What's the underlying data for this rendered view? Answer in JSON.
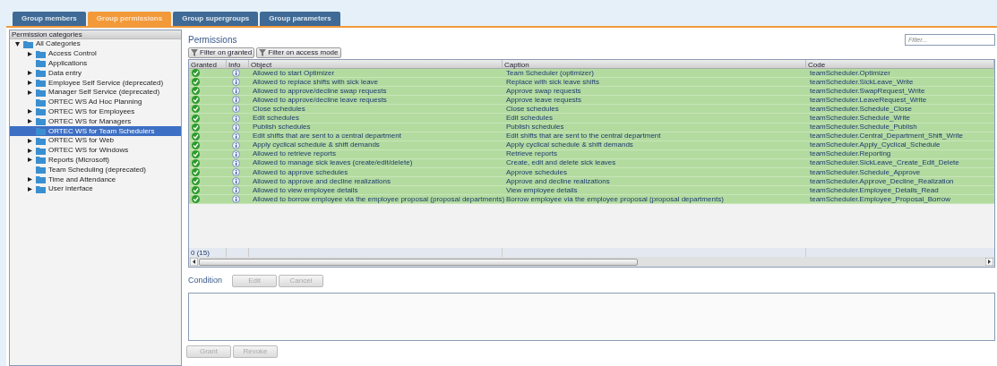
{
  "tabs": [
    {
      "label": "Group members",
      "selected": false
    },
    {
      "label": "Group permissions",
      "selected": true
    },
    {
      "label": "Group supergroups",
      "selected": false
    },
    {
      "label": "Group parameters",
      "selected": false
    }
  ],
  "categories": {
    "header": "Permission categories",
    "tree": [
      {
        "label": "All Categories",
        "expandable": true,
        "expanded": true,
        "selected": false,
        "children": [
          {
            "label": "Access Control",
            "expandable": true,
            "expanded": false,
            "selected": false
          },
          {
            "label": "Applications",
            "expandable": false,
            "expanded": false,
            "selected": false
          },
          {
            "label": "Data entry",
            "expandable": true,
            "expanded": false,
            "selected": false
          },
          {
            "label": "Employee Self Service (deprecated)",
            "expandable": true,
            "expanded": false,
            "selected": false
          },
          {
            "label": "Manager Self Service (deprecated)",
            "expandable": true,
            "expanded": false,
            "selected": false
          },
          {
            "label": "ORTEC WS Ad Hoc Planning",
            "expandable": false,
            "expanded": false,
            "selected": false
          },
          {
            "label": "ORTEC WS for Employees",
            "expandable": true,
            "expanded": false,
            "selected": false
          },
          {
            "label": "ORTEC WS for Managers",
            "expandable": true,
            "expanded": false,
            "selected": false
          },
          {
            "label": "ORTEC WS for Team Schedulers",
            "expandable": false,
            "expanded": false,
            "selected": true
          },
          {
            "label": "ORTEC WS for Web",
            "expandable": true,
            "expanded": false,
            "selected": false
          },
          {
            "label": "ORTEC WS for Windows",
            "expandable": true,
            "expanded": false,
            "selected": false
          },
          {
            "label": "Reports (Microsoft)",
            "expandable": true,
            "expanded": false,
            "selected": false
          },
          {
            "label": "Team Scheduling (deprecated)",
            "expandable": false,
            "expanded": false,
            "selected": false
          },
          {
            "label": "Time and Attendance",
            "expandable": true,
            "expanded": false,
            "selected": false
          },
          {
            "label": "User interface",
            "expandable": true,
            "expanded": false,
            "selected": false
          }
        ]
      }
    ]
  },
  "permissions": {
    "title": "Permissions",
    "filter": {
      "placeholder": "Filter..."
    },
    "filter_buttons": [
      "Filter on granted",
      "Filter on access mode"
    ],
    "table": {
      "columns": [
        "Granted",
        "Info",
        "Object",
        "Caption",
        "Code"
      ],
      "rows": [
        {
          "granted": true,
          "object": "Allowed to start Optimizer",
          "caption": "Team Scheduler (optimizer)",
          "code": "teamScheduler.Optimizer"
        },
        {
          "granted": true,
          "object": "Allowed to replace shifts with sick leave",
          "caption": "Replace with sick leave shifts",
          "code": "teamScheduler.SickLeave_Write"
        },
        {
          "granted": true,
          "object": "Allowed to approve/decline swap requests",
          "caption": "Approve swap requests",
          "code": "teamScheduler.SwapRequest_Write"
        },
        {
          "granted": true,
          "object": "Allowed to approve/decline leave requests",
          "caption": "Approve leave requests",
          "code": "teamScheduler.LeaveRequest_Write"
        },
        {
          "granted": true,
          "object": "Close schedules",
          "caption": "Close schedules",
          "code": "teamScheduler.Schedule_Close"
        },
        {
          "granted": true,
          "object": "Edit schedules",
          "caption": "Edit schedules",
          "code": "teamScheduler.Schedule_Write"
        },
        {
          "granted": true,
          "object": "Publish schedules",
          "caption": "Publish schedules",
          "code": "teamScheduler.Schedule_Publish"
        },
        {
          "granted": true,
          "object": "Edit shifts that are sent to a central department",
          "caption": "Edit shifts that are sent to the central department",
          "code": "teamScheduler.Central_Department_Shift_Write"
        },
        {
          "granted": true,
          "object": "Apply cyclical schedule & shift demands",
          "caption": "Apply cyclical schedule & shift demands",
          "code": "teamScheduler.Apply_Cyclical_Schedule"
        },
        {
          "granted": true,
          "object": "Allowed to retrieve reports",
          "caption": "Retrieve reports",
          "code": "teamScheduler.Reporting"
        },
        {
          "granted": true,
          "object": "Allowed to manage sick leaves (create/edit/delete)",
          "caption": "Create, edit and delete sick leaves",
          "code": "teamScheduler.SickLeave_Create_Edit_Delete"
        },
        {
          "granted": true,
          "object": "Allowed to approve schedules",
          "caption": "Approve schedules",
          "code": "teamScheduler.Schedule_Approve"
        },
        {
          "granted": true,
          "object": "Allowed to approve and decline realizations",
          "caption": "Approve and decline realizations",
          "code": "teamScheduler.Approve_Decline_Realization"
        },
        {
          "granted": true,
          "object": "Allowed to view employee details",
          "caption": "View employee details",
          "code": "teamScheduler.Employee_Details_Read"
        },
        {
          "granted": true,
          "object": "Allowed to borrow employee via the employee proposal (proposal departments)",
          "caption": "Borrow employee via the employee proposal (proposal departments)",
          "code": "teamScheduler.Employee_Proposal_Borrow"
        }
      ],
      "footer": "0 (15)"
    },
    "condition": {
      "label": "Condition",
      "buttons": [
        {
          "label": "Edit",
          "disabled": true
        },
        {
          "label": "Cancel",
          "disabled": true
        }
      ]
    },
    "actions": [
      {
        "label": "Grant",
        "disabled": true
      },
      {
        "label": "Revoke",
        "disabled": true
      }
    ]
  }
}
